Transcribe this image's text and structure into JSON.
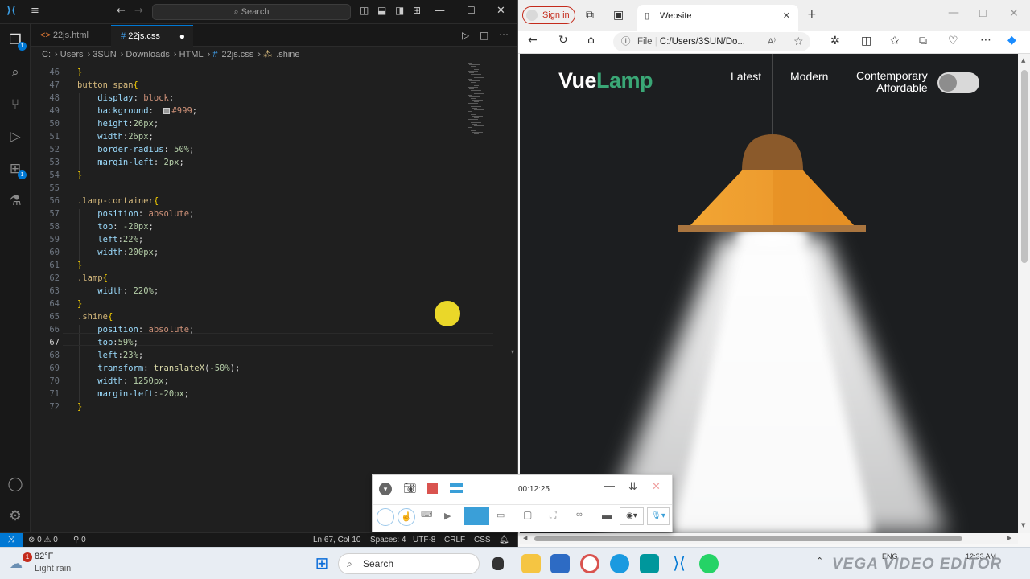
{
  "vscode": {
    "search_placeholder": "Search",
    "tabs": [
      {
        "icon": "<>",
        "label": "22js.html"
      },
      {
        "icon": "#",
        "label": "22js.css"
      }
    ],
    "breadcrumb": [
      "C:",
      "Users",
      "3SUN",
      "Downloads",
      "HTML",
      "22js.css",
      ".shine"
    ],
    "breadcrumb_css_icon": "#",
    "breadcrumb_sel_icon": "⁂",
    "activity_badges": [
      "1",
      "1"
    ],
    "code_lines": [
      {
        "n": "46",
        "t": "}"
      },
      {
        "n": "47",
        "t": "button span{"
      },
      {
        "n": "48",
        "t": "    display: block;"
      },
      {
        "n": "49",
        "t": "    background:  #999;"
      },
      {
        "n": "50",
        "t": "    height:26px;"
      },
      {
        "n": "51",
        "t": "    width:26px;"
      },
      {
        "n": "52",
        "t": "    border-radius: 50%;"
      },
      {
        "n": "53",
        "t": "    margin-left: 2px;"
      },
      {
        "n": "54",
        "t": "}"
      },
      {
        "n": "55",
        "t": ""
      },
      {
        "n": "56",
        "t": ".lamp-container{"
      },
      {
        "n": "57",
        "t": "    position: absolute;"
      },
      {
        "n": "58",
        "t": "    top: -20px;"
      },
      {
        "n": "59",
        "t": "    left:22%;"
      },
      {
        "n": "60",
        "t": "    width:200px;"
      },
      {
        "n": "61",
        "t": "}"
      },
      {
        "n": "62",
        "t": ".lamp{"
      },
      {
        "n": "63",
        "t": "    width: 220%;"
      },
      {
        "n": "64",
        "t": "}"
      },
      {
        "n": "65",
        "t": ".shine{"
      },
      {
        "n": "66",
        "t": "    position: absolute;"
      },
      {
        "n": "67",
        "t": "    top:59%;"
      },
      {
        "n": "68",
        "t": "    left:23%;"
      },
      {
        "n": "69",
        "t": "    transform: translateX(-50%);"
      },
      {
        "n": "70",
        "t": "    width: 1250px;"
      },
      {
        "n": "71",
        "t": "    margin-left:-20px;"
      },
      {
        "n": "72",
        "t": "}"
      }
    ],
    "status": {
      "errors": "0",
      "warnings": "0",
      "ports": "0",
      "position": "Ln 67, Col 10",
      "spaces": "Spaces: 4",
      "encoding": "UTF-8",
      "eol": "CRLF",
      "language": "CSS"
    }
  },
  "browser": {
    "signin_label": "Sign in",
    "tab_title": "Website",
    "address_prefix": "File",
    "address": "C:/Users/3SUN/Do...",
    "page": {
      "logo_part1": "Vue",
      "logo_part2": "Lamp",
      "nav": [
        "Latest",
        "Modern"
      ],
      "nav_multi": "Contemporary",
      "nav_multi_2": "Affordable",
      "toggle_on": false
    }
  },
  "recorder": {
    "timer": "00:12:25"
  },
  "taskbar": {
    "weather_temp": "82°F",
    "weather_desc": "Light rain",
    "weather_badge": "1",
    "search_label": "Search",
    "lang": "ENG",
    "time": "12:33 AM",
    "watermark": "VEGA VIDEO EDITOR"
  },
  "colors": {
    "vscode_bg": "#1f1f1f",
    "accent": "#0078d4",
    "logo_green": "#3aa776",
    "lamp_orange": "#f0a030",
    "lamp_cap": "#8b5a2b",
    "page_bg": "#1c1e20"
  }
}
